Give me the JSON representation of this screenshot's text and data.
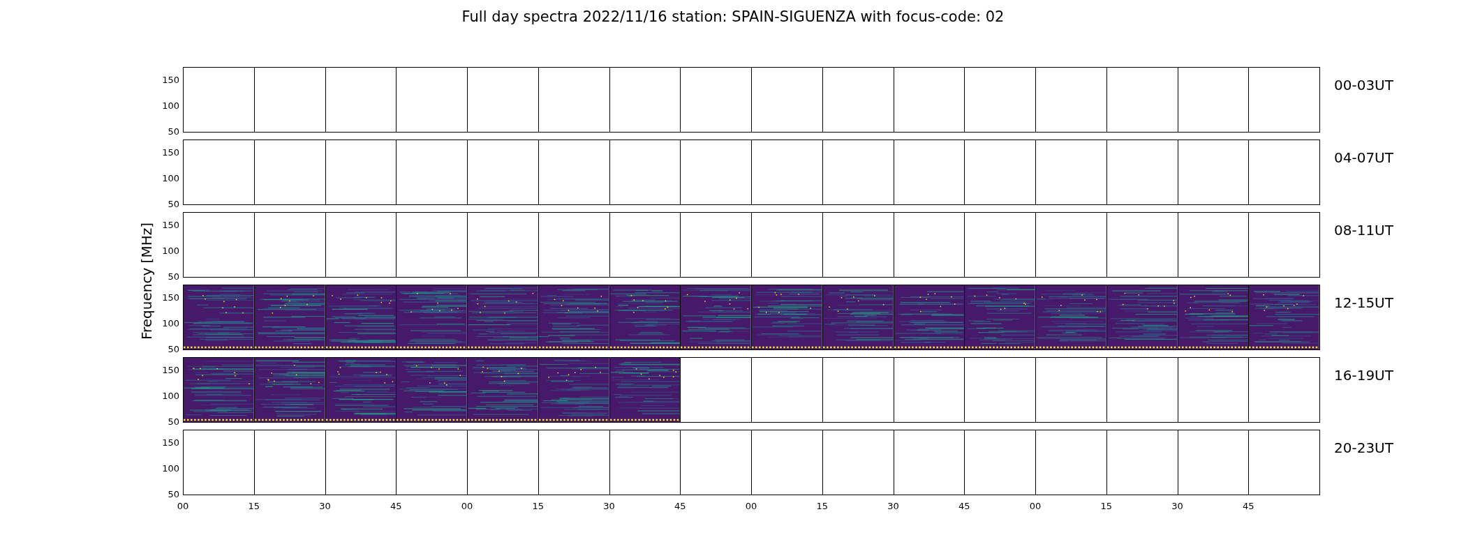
{
  "title": "Full day spectra 2022/11/16 station: SPAIN-SIGUENZA with focus-code: 02",
  "ylabel": "Frequency [MHz]",
  "xticks": [
    "00",
    "15",
    "30",
    "45",
    "00",
    "15",
    "30",
    "45",
    "00",
    "15",
    "30",
    "45",
    "00",
    "15",
    "30",
    "45"
  ],
  "rows": [
    {
      "label": "00-03UT",
      "yticks": [
        "150",
        "100",
        "50"
      ],
      "panels": [
        {
          "has_data": false
        },
        {
          "has_data": false
        },
        {
          "has_data": false
        },
        {
          "has_data": false
        },
        {
          "has_data": false
        },
        {
          "has_data": false
        },
        {
          "has_data": false
        },
        {
          "has_data": false
        },
        {
          "has_data": false
        },
        {
          "has_data": false
        },
        {
          "has_data": false
        },
        {
          "has_data": false
        },
        {
          "has_data": false
        },
        {
          "has_data": false
        },
        {
          "has_data": false
        },
        {
          "has_data": false
        }
      ]
    },
    {
      "label": "04-07UT",
      "yticks": [
        "150",
        "100",
        "50"
      ],
      "panels": [
        {
          "has_data": false
        },
        {
          "has_data": false
        },
        {
          "has_data": false
        },
        {
          "has_data": false
        },
        {
          "has_data": false
        },
        {
          "has_data": false
        },
        {
          "has_data": false
        },
        {
          "has_data": false
        },
        {
          "has_data": false
        },
        {
          "has_data": false
        },
        {
          "has_data": false
        },
        {
          "has_data": false
        },
        {
          "has_data": false
        },
        {
          "has_data": false
        },
        {
          "has_data": false
        },
        {
          "has_data": false
        }
      ]
    },
    {
      "label": "08-11UT",
      "yticks": [
        "150",
        "100",
        "50"
      ],
      "panels": [
        {
          "has_data": false
        },
        {
          "has_data": false
        },
        {
          "has_data": false
        },
        {
          "has_data": false
        },
        {
          "has_data": false
        },
        {
          "has_data": false
        },
        {
          "has_data": false
        },
        {
          "has_data": false
        },
        {
          "has_data": false
        },
        {
          "has_data": false
        },
        {
          "has_data": false
        },
        {
          "has_data": false
        },
        {
          "has_data": false
        },
        {
          "has_data": false
        },
        {
          "has_data": false
        },
        {
          "has_data": false
        }
      ]
    },
    {
      "label": "12-15UT",
      "yticks": [
        "150",
        "100",
        "50"
      ],
      "panels": [
        {
          "has_data": true
        },
        {
          "has_data": true
        },
        {
          "has_data": true
        },
        {
          "has_data": true
        },
        {
          "has_data": true
        },
        {
          "has_data": true
        },
        {
          "has_data": true
        },
        {
          "has_data": true
        },
        {
          "has_data": true
        },
        {
          "has_data": true
        },
        {
          "has_data": true
        },
        {
          "has_data": true
        },
        {
          "has_data": true
        },
        {
          "has_data": true
        },
        {
          "has_data": true
        },
        {
          "has_data": true
        }
      ]
    },
    {
      "label": "16-19UT",
      "yticks": [
        "150",
        "100",
        "50"
      ],
      "panels": [
        {
          "has_data": true
        },
        {
          "has_data": true
        },
        {
          "has_data": true
        },
        {
          "has_data": true
        },
        {
          "has_data": true
        },
        {
          "has_data": true
        },
        {
          "has_data": true
        },
        {
          "has_data": false
        },
        {
          "has_data": false
        },
        {
          "has_data": false
        },
        {
          "has_data": false
        },
        {
          "has_data": false
        },
        {
          "has_data": false
        },
        {
          "has_data": false
        },
        {
          "has_data": false
        },
        {
          "has_data": false
        }
      ]
    },
    {
      "label": "20-23UT",
      "yticks": [
        "150",
        "100",
        "50"
      ],
      "panels": [
        {
          "has_data": false
        },
        {
          "has_data": false
        },
        {
          "has_data": false
        },
        {
          "has_data": false
        },
        {
          "has_data": false
        },
        {
          "has_data": false
        },
        {
          "has_data": false
        },
        {
          "has_data": false
        },
        {
          "has_data": false
        },
        {
          "has_data": false
        },
        {
          "has_data": false
        },
        {
          "has_data": false
        },
        {
          "has_data": false
        },
        {
          "has_data": false
        },
        {
          "has_data": false
        },
        {
          "has_data": false
        }
      ]
    }
  ]
}
